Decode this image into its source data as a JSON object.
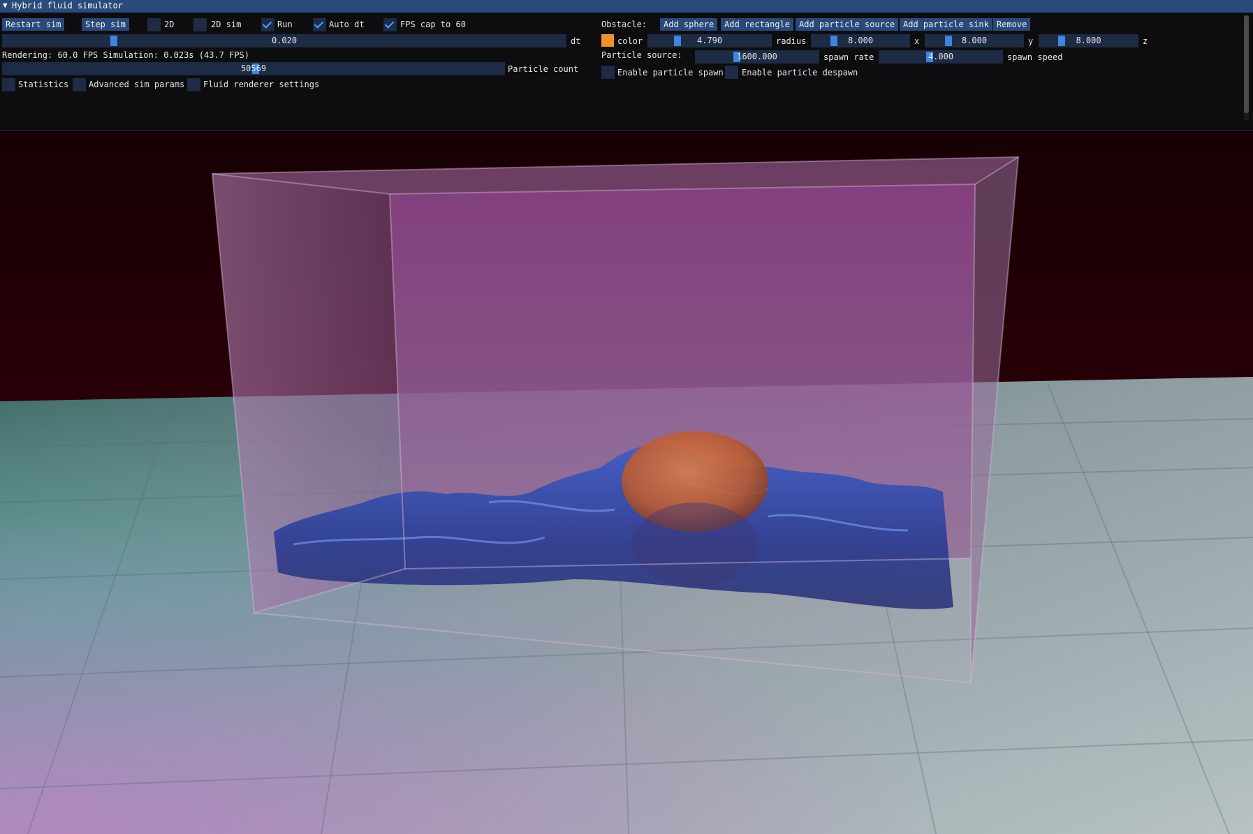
{
  "window": {
    "title": "Hybrid fluid simulator"
  },
  "controls": {
    "restart_label": "Restart sim",
    "step_label": "Step sim",
    "chk_2d": "2D",
    "chk_2d_sim": "2D sim",
    "chk_run": "Run",
    "chk_auto_dt": "Auto dt",
    "chk_fps_cap": "FPS cap to 60",
    "dt_value": "0.020",
    "dt_label": "dt",
    "status": "Rendering: 60.0 FPS  Simulation: 0.023s (43.7 FPS)",
    "particle_count_value": "50569",
    "particle_count_label": "Particle count",
    "chk_statistics": "Statistics",
    "chk_advanced": "Advanced sim params",
    "chk_fluid_renderer": "Fluid renderer settings",
    "checked": {
      "2d": false,
      "2d_sim": false,
      "run": true,
      "auto_dt": true,
      "fps_cap": true,
      "statistics": false,
      "advanced": false,
      "fluid_renderer": false
    }
  },
  "obstacle": {
    "label": "Obstacle:",
    "add_sphere": "Add sphere",
    "add_rectangle": "Add rectangle",
    "add_particle_source": "Add particle source",
    "add_particle_sink": "Add particle sink",
    "remove": "Remove",
    "color_label": "color",
    "color": "#f0922a",
    "radius_value": "4.790",
    "radius_label": "radius",
    "x_value": "8.000",
    "x_label": "x",
    "y_value": "8.000",
    "y_label": "y",
    "z_value": "8.000",
    "z_label": "z"
  },
  "particle_source": {
    "label": "Particle source:",
    "spawn_rate_value": "1600.000",
    "spawn_rate_label": "spawn rate",
    "spawn_speed_value": "4.000",
    "spawn_speed_label": "spawn speed",
    "enable_spawn": "Enable particle spawn",
    "enable_despawn": "Enable particle despawn"
  },
  "theme": {
    "accent": "#294a7a",
    "frame_bg": "#1d2b45",
    "grab": "#3d85e0",
    "check": "#4da3ff"
  }
}
